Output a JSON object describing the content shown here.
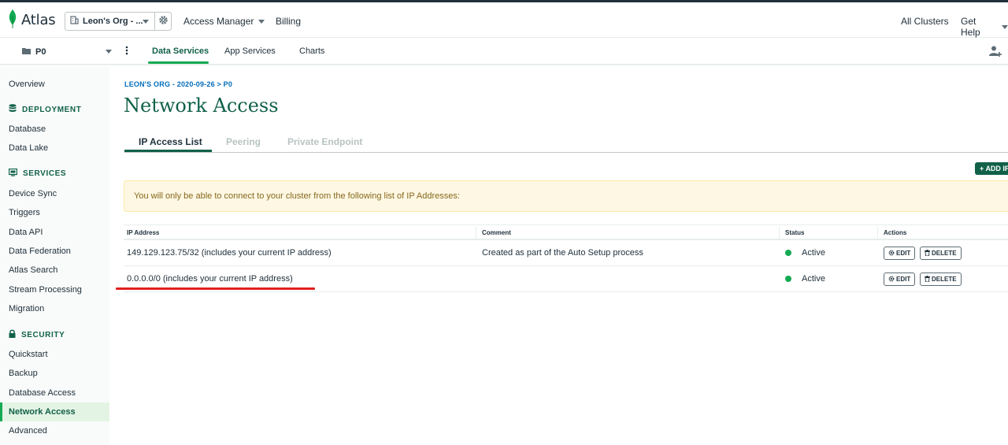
{
  "topbar": {
    "logo": "Atlas",
    "org": "Leon's Org - ...",
    "access_manager": "Access Manager",
    "billing": "Billing",
    "all_clusters": "All Clusters",
    "get_help": "Get Help"
  },
  "subbar": {
    "project": "P0",
    "tabs": [
      "Data Services",
      "App Services",
      "Charts"
    ],
    "active_tab": "Data Services"
  },
  "sidebar": {
    "overview": "Overview",
    "deployment": {
      "title": "DEPLOYMENT",
      "items": [
        "Database",
        "Data Lake"
      ]
    },
    "services": {
      "title": "SERVICES",
      "items": [
        "Device Sync",
        "Triggers",
        "Data API",
        "Data Federation",
        "Atlas Search",
        "Stream Processing",
        "Migration"
      ]
    },
    "security": {
      "title": "SECURITY",
      "items": [
        "Quickstart",
        "Backup",
        "Database Access",
        "Network Access",
        "Advanced"
      ]
    },
    "active_item": "Network Access"
  },
  "main": {
    "breadcrumb": "LEON'S ORG - 2020-09-26 > P0",
    "title": "Network Access",
    "tabs": [
      "IP Access List",
      "Peering",
      "Private Endpoint"
    ],
    "active_tab": "IP Access List",
    "add_button": "ADD IP",
    "banner": "You will only be able to connect to your cluster from the following list of IP Addresses:"
  },
  "table": {
    "headers": [
      "IP Address",
      "Comment",
      "Status",
      "Actions"
    ],
    "rows": [
      {
        "ip": "149.129.123.75/32  (includes your current IP address)",
        "comment": "Created as part of the Auto Setup process",
        "status": "Active",
        "edit": "EDIT",
        "delete": "DELETE"
      },
      {
        "ip": "0.0.0.0/0  (includes your current IP address)",
        "comment": "",
        "status": "Active",
        "edit": "EDIT",
        "delete": "DELETE"
      }
    ]
  },
  "colors": {
    "brand_green": "#116149",
    "accent_green": "#13aa52",
    "link_blue": "#006cbc",
    "warning_bg": "#fef7e3",
    "annotation_red": "#e02020"
  }
}
